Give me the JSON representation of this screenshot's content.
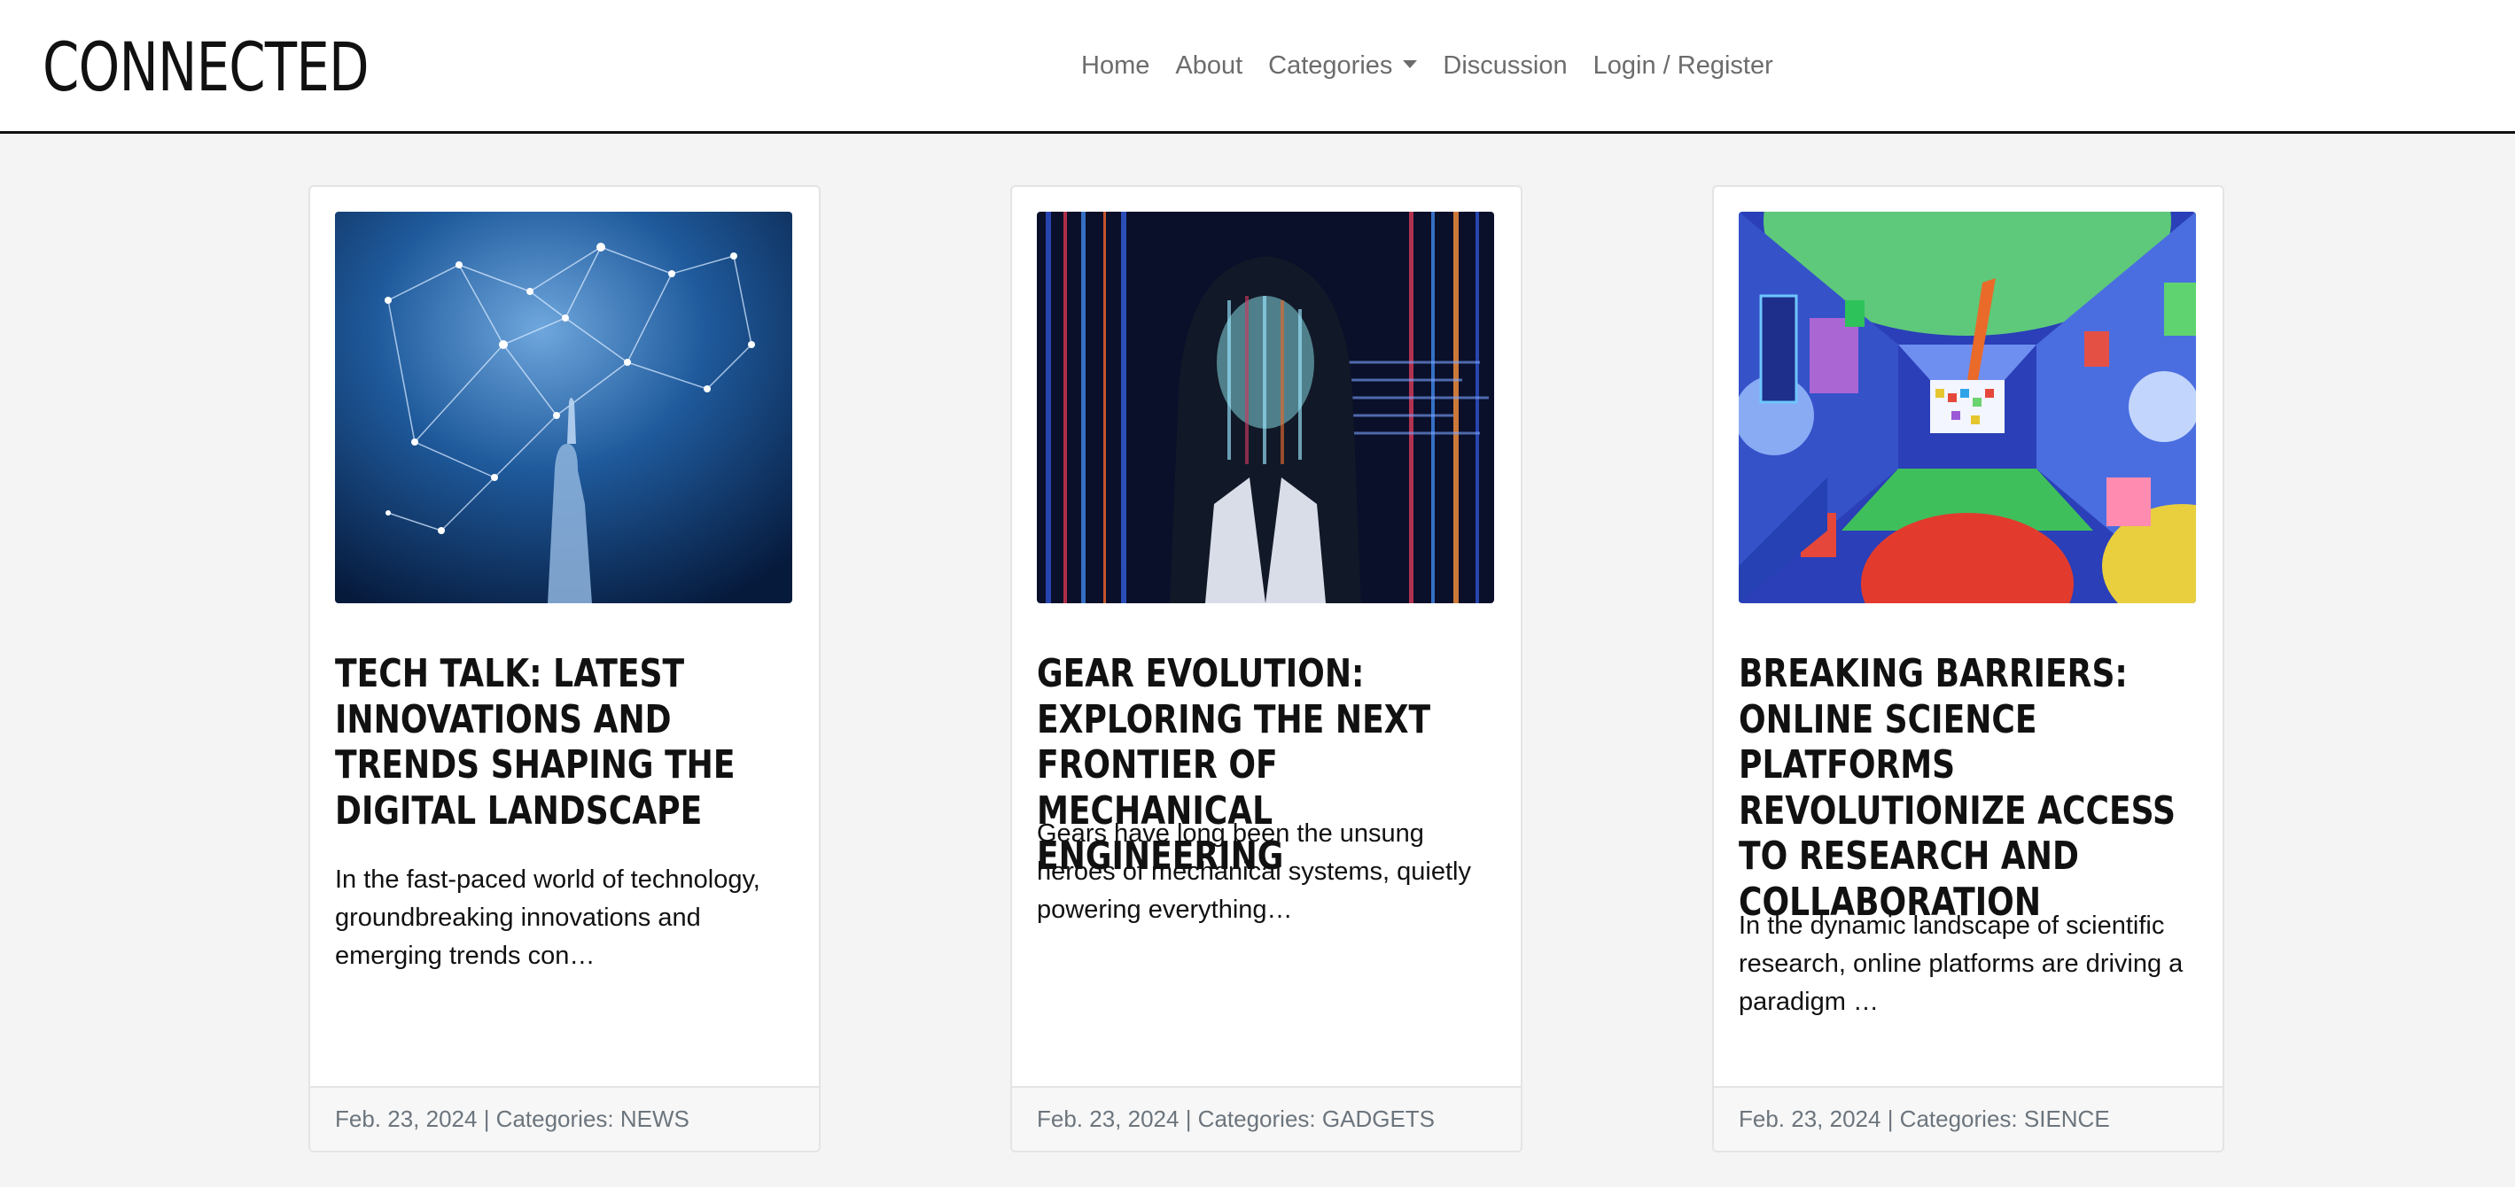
{
  "site": {
    "brand": "CONNECTED"
  },
  "nav": {
    "items": [
      {
        "label": "Home"
      },
      {
        "label": "About"
      },
      {
        "label": "Categories"
      },
      {
        "label": "Discussion"
      },
      {
        "label": "Login / Register"
      }
    ]
  },
  "posts": [
    {
      "title": "TECH TALK: LATEST INNOVATIONS AND TRENDS SHAPING THE DIGITAL LANDSCAPE",
      "excerpt": "In the fast-paced world of technology, groundbreaking innovations and emerging trends con…",
      "date": "Feb. 23, 2024",
      "categories_label": "| Categories:",
      "category": "NEWS",
      "image_icon": "network-hand-image"
    },
    {
      "title": "GEAR EVOLUTION: EXPLORING THE NEXT FRONTIER OF MECHANICAL ENGINEERING",
      "excerpt": "Gears have long been the unsung heroes of mechanical systems, quietly powering everything…",
      "date": "Feb. 23, 2024",
      "categories_label": "| Categories:",
      "category": "GADGETS",
      "image_icon": "code-projection-portrait-image"
    },
    {
      "title": "BREAKING BARRIERS: ONLINE SCIENCE PLATFORMS REVOLUTIONIZE ACCESS TO RESEARCH AND COLLABORATION",
      "excerpt": "In the dynamic landscape of scientific research, online platforms are driving a paradigm …",
      "date": "Feb. 23, 2024",
      "categories_label": "| Categories:",
      "category": "SIENCE",
      "image_icon": "abstract-corridor-image"
    }
  ],
  "colors": {
    "background": "#f4f4f4",
    "card": "#ffffff",
    "nav_link": "#6c6c6c",
    "footer_text": "#6c757d"
  }
}
